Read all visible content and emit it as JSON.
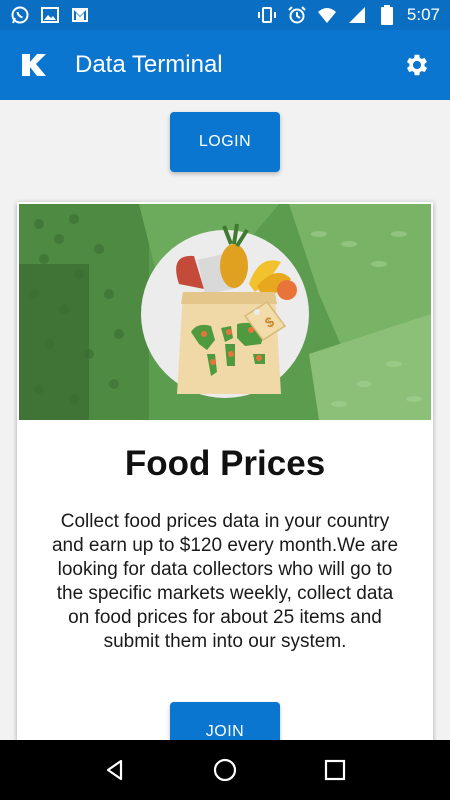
{
  "status_bar": {
    "time": "5:07",
    "left_icons": [
      "whatsapp-icon",
      "image-icon",
      "gmail-icon"
    ],
    "right_icons": [
      "vibrate-icon",
      "alarm-icon",
      "wifi-icon",
      "signal-icon",
      "battery-icon"
    ]
  },
  "app_bar": {
    "logo": "K",
    "title": "Data Terminal",
    "settings_icon": "gear-icon"
  },
  "login_button": {
    "label": "LOGIN"
  },
  "card": {
    "title": "Food Prices",
    "description": "Collect food prices data in your country and earn up to $120 every month.We are looking for data collectors who will go to the specific markets weekly, collect data on food prices for about 25 items and submit them into our system.",
    "join_label": "JOIN",
    "hero_tag": "$"
  },
  "nav_bar": {
    "buttons": [
      "back-icon",
      "home-icon",
      "recents-icon"
    ]
  },
  "colors": {
    "primary": "#0a76d0",
    "status_bar": "#0a6fc2",
    "hero_green": "#5b9a4e"
  }
}
